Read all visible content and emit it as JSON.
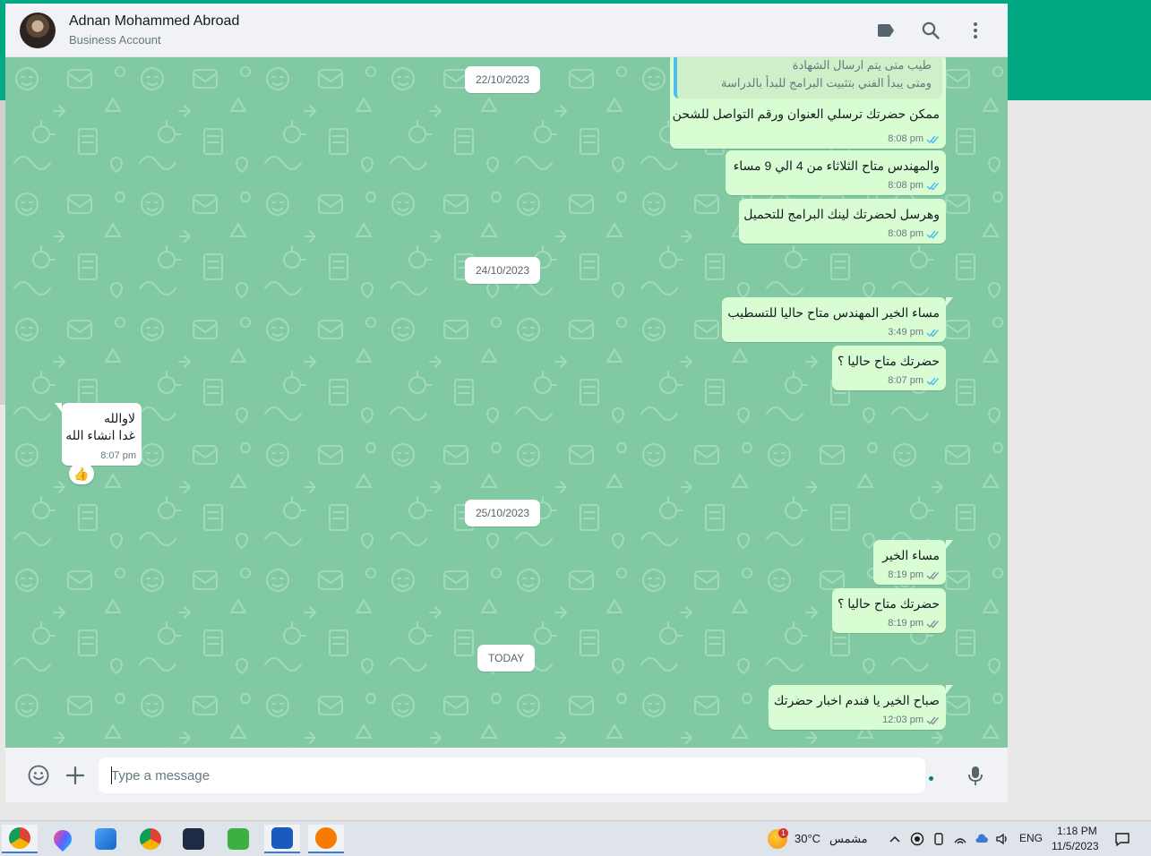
{
  "header": {
    "contact_name": "Adnan Mohammed Abroad",
    "contact_subtitle": "Business Account",
    "icons": [
      "label-icon",
      "search-icon",
      "menu-dots-icon"
    ]
  },
  "quoted": {
    "line1": "طيب متى يتم ارسال الشهادة",
    "line2": "ومتى يبدأ الفني بتثبيت البرامج للبدأ بالدراسة"
  },
  "dates": {
    "d1": "22/10/2023",
    "d2": "24/10/2023",
    "d3": "25/10/2023",
    "d4": "TODAY"
  },
  "messages": [
    {
      "dir": "out",
      "text": "ممكن حضرتك ترسلي العنوان ورقم التواصل للشحن",
      "time": "8:08 pm"
    },
    {
      "dir": "out",
      "text": "والمهندس متاح الثلاثاء من 4 الي 9 مساء",
      "time": "8:08 pm"
    },
    {
      "dir": "out",
      "text": "وهرسل لحضرتك لينك البرامج للتحميل",
      "time": "8:08 pm"
    },
    {
      "dir": "out",
      "text": "مساء الخير المهندس متاح حاليا للتسطيب",
      "time": "3:49 pm"
    },
    {
      "dir": "out",
      "text": "حضرتك متاح حاليا ؟",
      "time": "8:07 pm"
    },
    {
      "dir": "in",
      "line1": "لاوالله",
      "line2": "غدا انشاء الله",
      "time": "8:07 pm",
      "reaction": "👍"
    },
    {
      "dir": "out",
      "text": "مساء الخير",
      "time": "8:19 pm"
    },
    {
      "dir": "out",
      "text": "حضرتك متاح حاليا ؟",
      "time": "8:19 pm"
    },
    {
      "dir": "out",
      "text": "صباح الخير يا فندم اخبار حضرتك",
      "time": "12:03 pm"
    }
  ],
  "composer": {
    "placeholder": "Type a message"
  },
  "taskbar": {
    "weather_temp": "30°C",
    "weather_text": "مشمس",
    "weather_badge": "1",
    "language": "ENG",
    "time": "1:18 PM",
    "date": "11/5/2023"
  },
  "colors": {
    "accent": "#00a884",
    "chat_bg": "#80c9a3",
    "outgoing_bubble": "#d9fdd3",
    "read_ticks": "#53bdeb"
  }
}
